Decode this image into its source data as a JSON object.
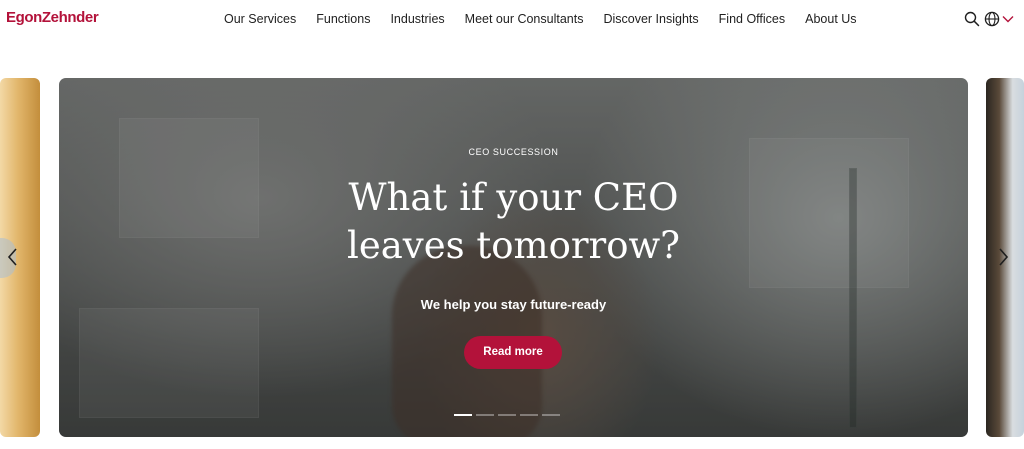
{
  "header": {
    "logo_text": "EgonZehnder",
    "nav": [
      {
        "label": "Our Services"
      },
      {
        "label": "Functions"
      },
      {
        "label": "Industries"
      },
      {
        "label": "Meet our Consultants"
      },
      {
        "label": "Discover Insights"
      },
      {
        "label": "Find Offices"
      },
      {
        "label": "About Us"
      }
    ],
    "icons": [
      "search-icon",
      "globe-icon",
      "chevron-down-icon"
    ]
  },
  "hero": {
    "eyebrow": "CEO SUCCESSION",
    "headline_line1": "What if your CEO",
    "headline_line2": "leaves tomorrow?",
    "subline": "We help you stay future-ready",
    "cta_label": "Read more",
    "slide_count": 5,
    "active_slide": 1
  },
  "carousel": {
    "prev_icon": "chevron-left-icon",
    "next_icon": "chevron-right-icon"
  },
  "colors": {
    "brand": "#b3123a",
    "text": "#1f1f1f",
    "hero_text": "#ffffff"
  }
}
